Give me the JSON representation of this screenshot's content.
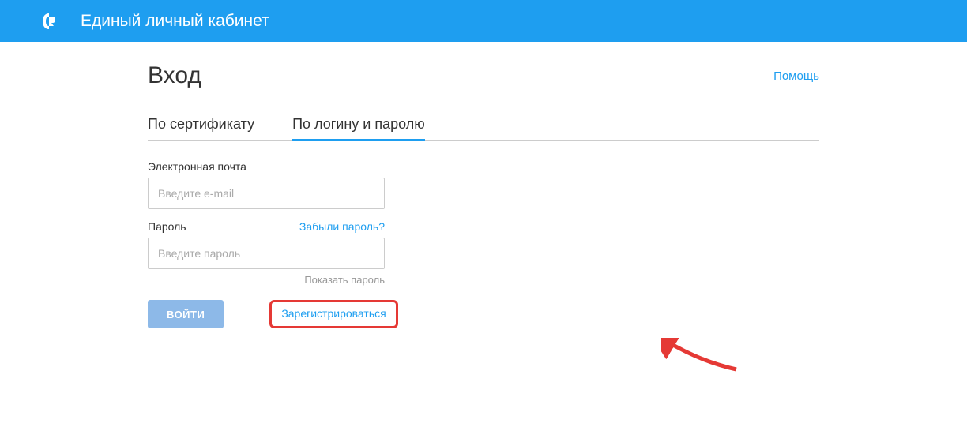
{
  "header": {
    "title": "Единый личный кабинет"
  },
  "page": {
    "title": "Вход",
    "help": "Помощь"
  },
  "tabs": {
    "cert": "По сертификату",
    "login": "По логину и паролю"
  },
  "form": {
    "email_label": "Электронная почта",
    "email_placeholder": "Введите e-mail",
    "password_label": "Пароль",
    "password_placeholder": "Введите пароль",
    "forgot": "Забыли пароль?",
    "show_password": "Показать пароль",
    "submit": "ВОЙТИ",
    "register": "Зарегистрироваться"
  }
}
